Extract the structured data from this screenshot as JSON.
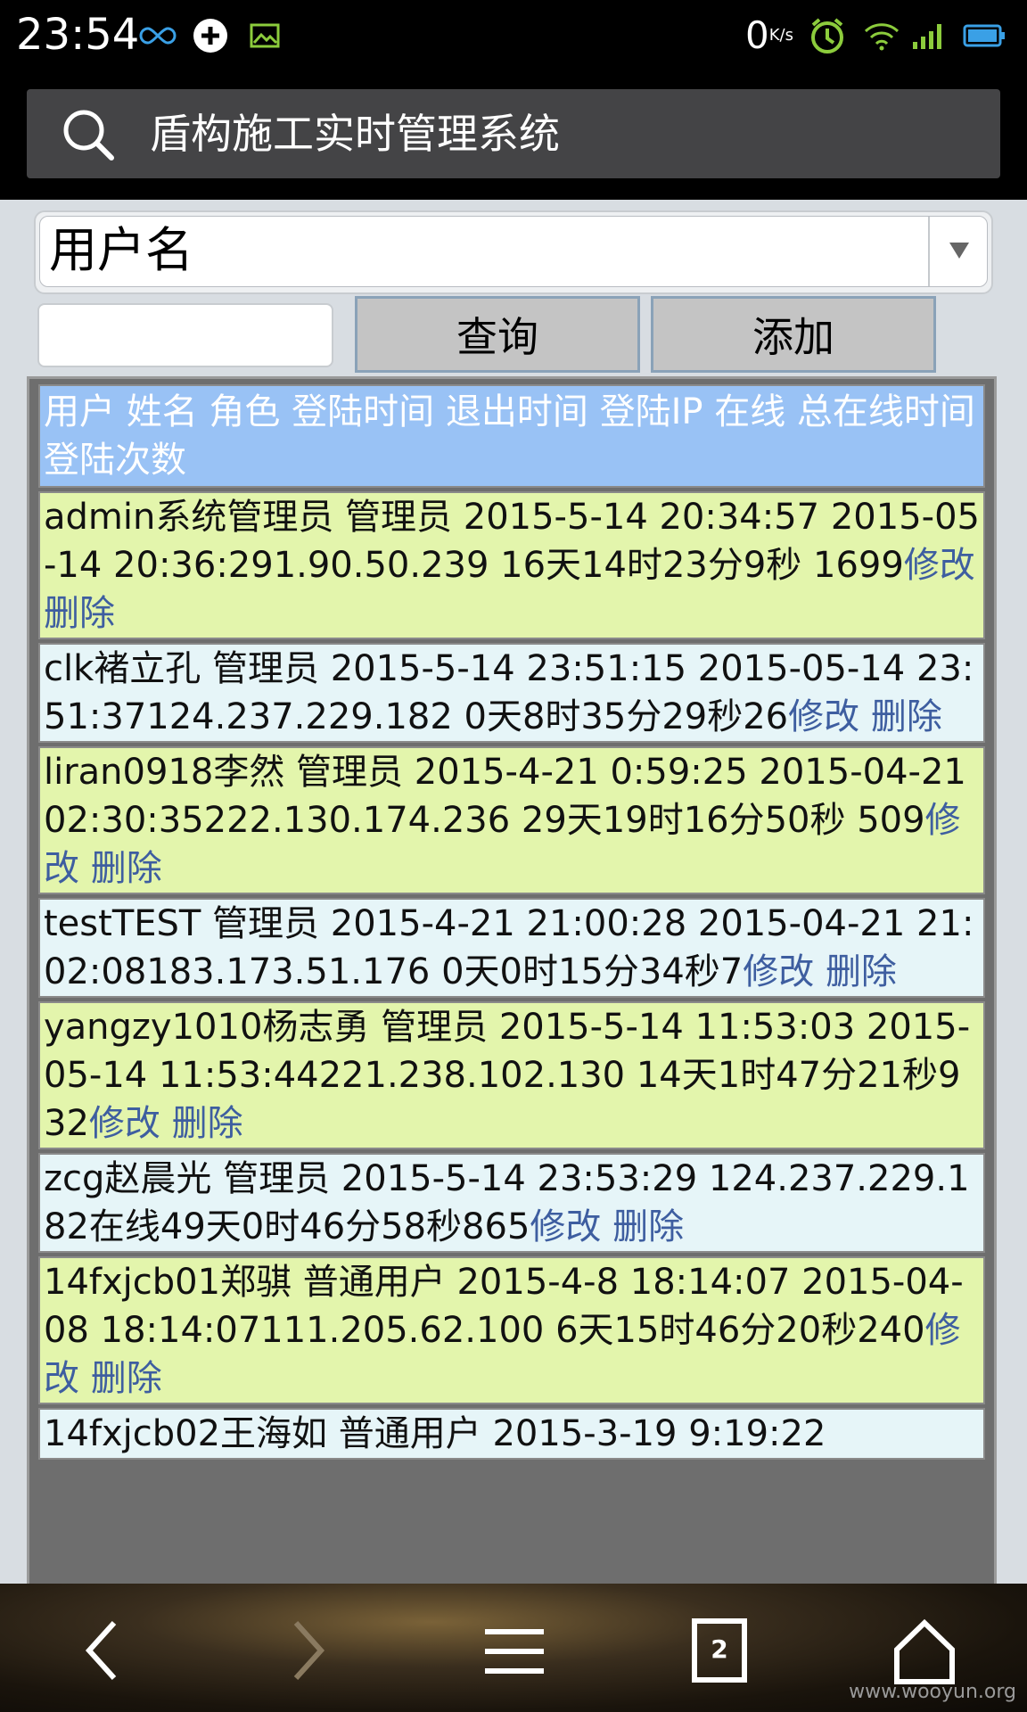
{
  "status_bar": {
    "time": "23:54",
    "net_speed": "0",
    "net_speed_unit": "K/s",
    "icons": [
      "infinity-icon",
      "sync-icon",
      "image-icon",
      "alarm-icon",
      "wifi-icon",
      "signal-icon",
      "battery-icon"
    ]
  },
  "browser": {
    "title": "盾构施工实时管理系统"
  },
  "filter": {
    "selected": "用户名",
    "search_value": "",
    "query_label": "查询",
    "add_label": "添加"
  },
  "table": {
    "header": "用户 姓名 角色 登陆时间 退出时间 登陆IP 在线 总在线时间 登陆次数",
    "rows": [
      {
        "text": "admin系统管理员 管理员 2015-5-14 20:34:57 2015-05-14 20:36:291.90.50.239 16天14时23分9秒 1699",
        "edit": "修改",
        "delete": "删除"
      },
      {
        "text": "clk褚立孔 管理员 2015-5-14 23:51:15 2015-05-14 23:51:37124.237.229.182 0天8时35分29秒26",
        "edit": "修改",
        "delete": "删除"
      },
      {
        "text": "liran0918李然 管理员 2015-4-21 0:59:25 2015-04-21 02:30:35222.130.174.236 29天19时16分50秒 509",
        "edit": "修改",
        "delete": "删除"
      },
      {
        "text": "testTEST 管理员 2015-4-21 21:00:28 2015-04-21 21:02:08183.173.51.176 0天0时15分34秒7",
        "edit": "修改",
        "delete": "删除"
      },
      {
        "text": "yangzy1010杨志勇 管理员 2015-5-14 11:53:03 2015-05-14 11:53:44221.238.102.130 14天1时47分21秒932",
        "edit": "修改",
        "delete": "删除"
      },
      {
        "text": "zcg赵晨光 管理员 2015-5-14 23:53:29 124.237.229.182在线49天0时46分58秒865",
        "edit": "修改",
        "delete": "删除"
      },
      {
        "text": "14fxjcb01郑骐 普通用户 2015-4-8 18:14:07 2015-04-08 18:14:07111.205.62.100 6天15时46分20秒240",
        "edit": "修改",
        "delete": "删除"
      },
      {
        "text": "14fxjcb02王海如 普通用户 2015-3-19 9:19:22",
        "edit": "",
        "delete": ""
      }
    ]
  },
  "nav": {
    "tab_count": "2",
    "watermark": "www.wooyun.org"
  }
}
